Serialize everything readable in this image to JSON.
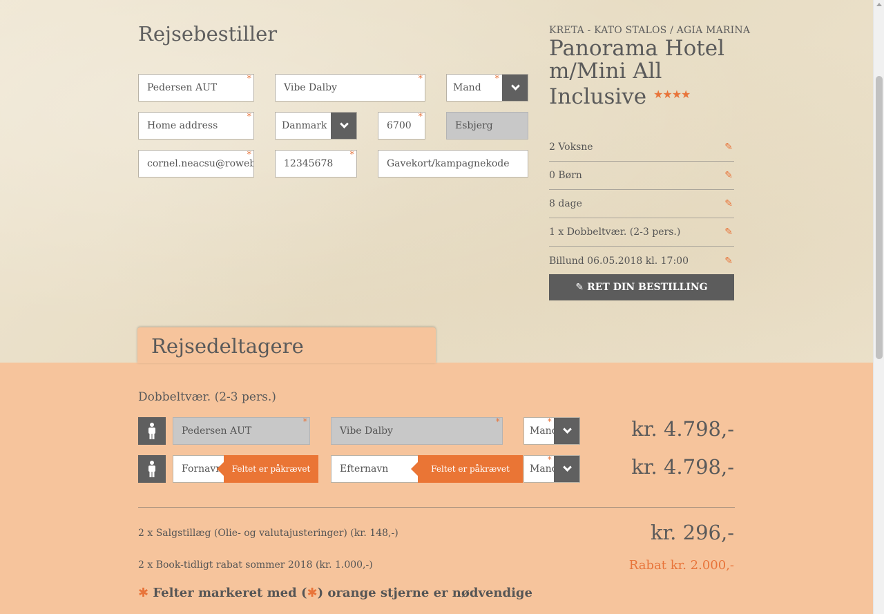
{
  "booker": {
    "title": "Rejsebestiller",
    "last_name": "Pedersen AUT",
    "first_name": "Vibe Dalby",
    "gender": "Mand",
    "address": "Home address",
    "country": "Danmark",
    "zip": "6700",
    "city": "Esbjerg",
    "email": "cornel.neacsu@roweb.rc",
    "phone": "12345678",
    "voucher_placeholder": "Gavekort/kampagnekode",
    "required_mark": "*"
  },
  "hotel": {
    "breadcrumb": "KRETA - KATO STALOS / AGIA MARINA",
    "name": "Panorama Hotel m/Mini All Inclusive",
    "stars": "★★★★",
    "star_count": 4
  },
  "summary": {
    "rows": [
      {
        "label": "2 Voksne"
      },
      {
        "label": "0 Børn"
      },
      {
        "label": "8 dage"
      },
      {
        "label": "1 x Dobbeltvær. (2-3 pers.)"
      },
      {
        "label": "Billund 06.05.2018 kl. 17:00"
      }
    ],
    "edit_button": "RET DIN BESTILLING"
  },
  "participants": {
    "tab_title": "Rejsedeltagere",
    "room_title": "Dobbeltvær. (2-3 pers.)",
    "rows": [
      {
        "last_name": "Pedersen AUT",
        "first_name": "Vibe Dalby",
        "gender": "Mand",
        "price": "kr. 4.798,-"
      },
      {
        "last_name_placeholder": "Fornavn",
        "first_name_placeholder": "Efternavn",
        "gender": "Mand",
        "price": "kr. 4.798,-",
        "error": "Feltet er påkrævet"
      }
    ]
  },
  "fees": [
    {
      "label": "2 x Salgstillæg (Olie- og valutajusteringer) (kr. 148,-)",
      "value": "kr. 296,-"
    },
    {
      "label": "2 x Book-tidligt rabat sommer 2018 (kr. 1.000,-)",
      "value": "Rabat kr. 2.000,-"
    }
  ],
  "note": {
    "before": "Felter markeret med (",
    "after": ") orange stjerne er nødvendige"
  },
  "colors": {
    "accent": "#e8743a",
    "dark_button": "#5c5c5c",
    "salmon_bg": "#f6c49c"
  }
}
